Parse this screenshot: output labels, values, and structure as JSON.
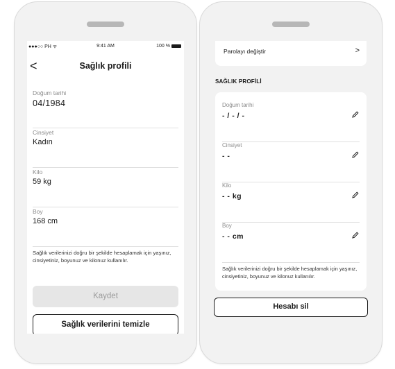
{
  "left_phone": {
    "status_bar": {
      "carrier": "●●●○○ PH ᯤ",
      "time": "9:41 AM",
      "battery": "100 %"
    },
    "header": {
      "back": "<",
      "title": "Sağlık profili"
    },
    "fields": [
      {
        "label": "Doğum tarihi",
        "value": "04/1984"
      },
      {
        "label": "Cinsiyet",
        "value": "Kadın"
      },
      {
        "label": "Kilo",
        "value": "59 kg"
      },
      {
        "label": "Boy",
        "value": "168 cm"
      }
    ],
    "hint": "Sağlık verilerinizi doğru bir şekilde hesaplamak için yaşınız, cinsiyetiniz, boyunuz ve kilonuz kullanılır.",
    "save_button": "Kaydet",
    "clear_button": "Sağlık verilerini temizle"
  },
  "right_phone": {
    "change_password": "Parolayı değiştir",
    "chevron": ">",
    "section_title": "SAĞLIK PROFİLİ",
    "fields": [
      {
        "label": "Doğum tarihi",
        "value": "- / - / -"
      },
      {
        "label": "Cinsiyet",
        "value": "- -"
      },
      {
        "label": "Kilo",
        "value": "- - kg"
      },
      {
        "label": "Boy",
        "value": "- - cm"
      }
    ],
    "hint": "Sağlık verilerinizi doğru bir şekilde hesaplamak için yaşınız, cinsiyetiniz, boyunuz ve kilonuz kullanılır.",
    "delete_button": "Hesabı sil"
  }
}
